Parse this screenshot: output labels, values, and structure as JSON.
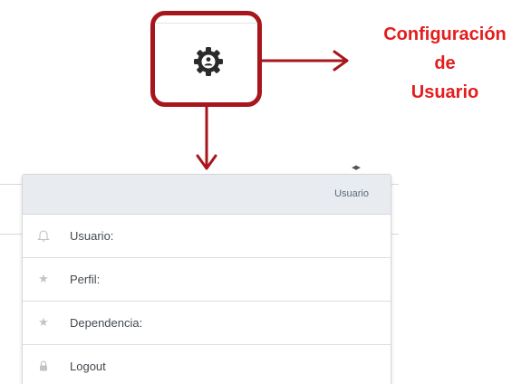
{
  "callout": {
    "line1": "Configuración",
    "line2": "de",
    "line3": "Usuario",
    "color": "#e41d1d",
    "frame_color": "#a8161d"
  },
  "gear": {
    "icon": "user-settings-gear-icon",
    "color": "#2b2b2b"
  },
  "menu": {
    "header_title": "Usuario",
    "items": [
      {
        "label": "Usuario:",
        "icon": "bell-icon"
      },
      {
        "label": "Perfil:",
        "icon": "star-icon"
      },
      {
        "label": "Dependencia:",
        "icon": "star-icon"
      },
      {
        "label": "Logout",
        "icon": "lock-icon"
      }
    ]
  }
}
